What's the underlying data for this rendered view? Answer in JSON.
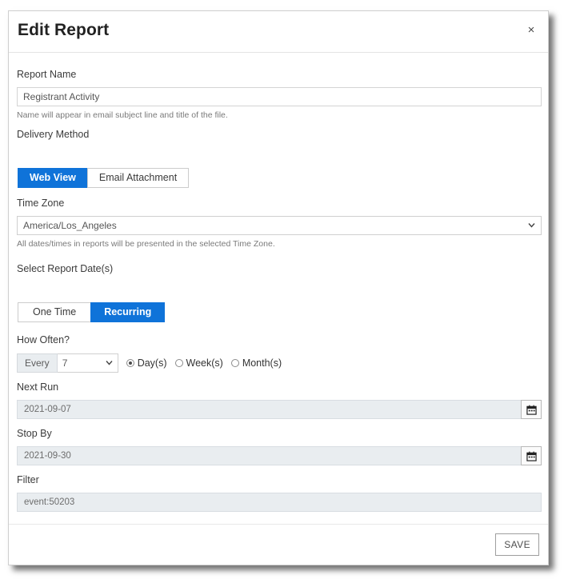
{
  "dialog": {
    "title": "Edit Report",
    "close_label": "×"
  },
  "report_name": {
    "label": "Report Name",
    "value": "Registrant Activity",
    "placeholder": "Report Name",
    "help": "Name will appear in email subject line and title of the file."
  },
  "delivery_method": {
    "label": "Delivery Method",
    "options": [
      {
        "label": "Web View",
        "selected": true
      },
      {
        "label": "Email Attachment",
        "selected": false
      }
    ]
  },
  "time_zone": {
    "label": "Time Zone",
    "value": "America/Los_Angeles",
    "help": "All dates/times in reports will be presented in the selected Time Zone.",
    "caret": "⌄"
  },
  "report_dates": {
    "label": "Select Report Date(s)",
    "options": [
      {
        "label": "One Time",
        "selected": false
      },
      {
        "label": "Recurring",
        "selected": true
      }
    ]
  },
  "how_often": {
    "label": "How Often?",
    "prefix": "Every",
    "interval_value": "7",
    "caret": "⌄",
    "units": [
      {
        "label": "Day(s)",
        "selected": true
      },
      {
        "label": "Week(s)",
        "selected": false
      },
      {
        "label": "Month(s)",
        "selected": false
      }
    ]
  },
  "next_run": {
    "label": "Next Run",
    "value": "2021-09-07"
  },
  "stop_by": {
    "label": "Stop By",
    "value": "2021-09-30"
  },
  "filter": {
    "label": "Filter",
    "value": "event:50203"
  },
  "footer": {
    "save_label": "SAVE"
  },
  "colors": {
    "accent": "#0f73d9",
    "readonly_bg": "#e9edf0",
    "border": "#cfcfcf"
  }
}
